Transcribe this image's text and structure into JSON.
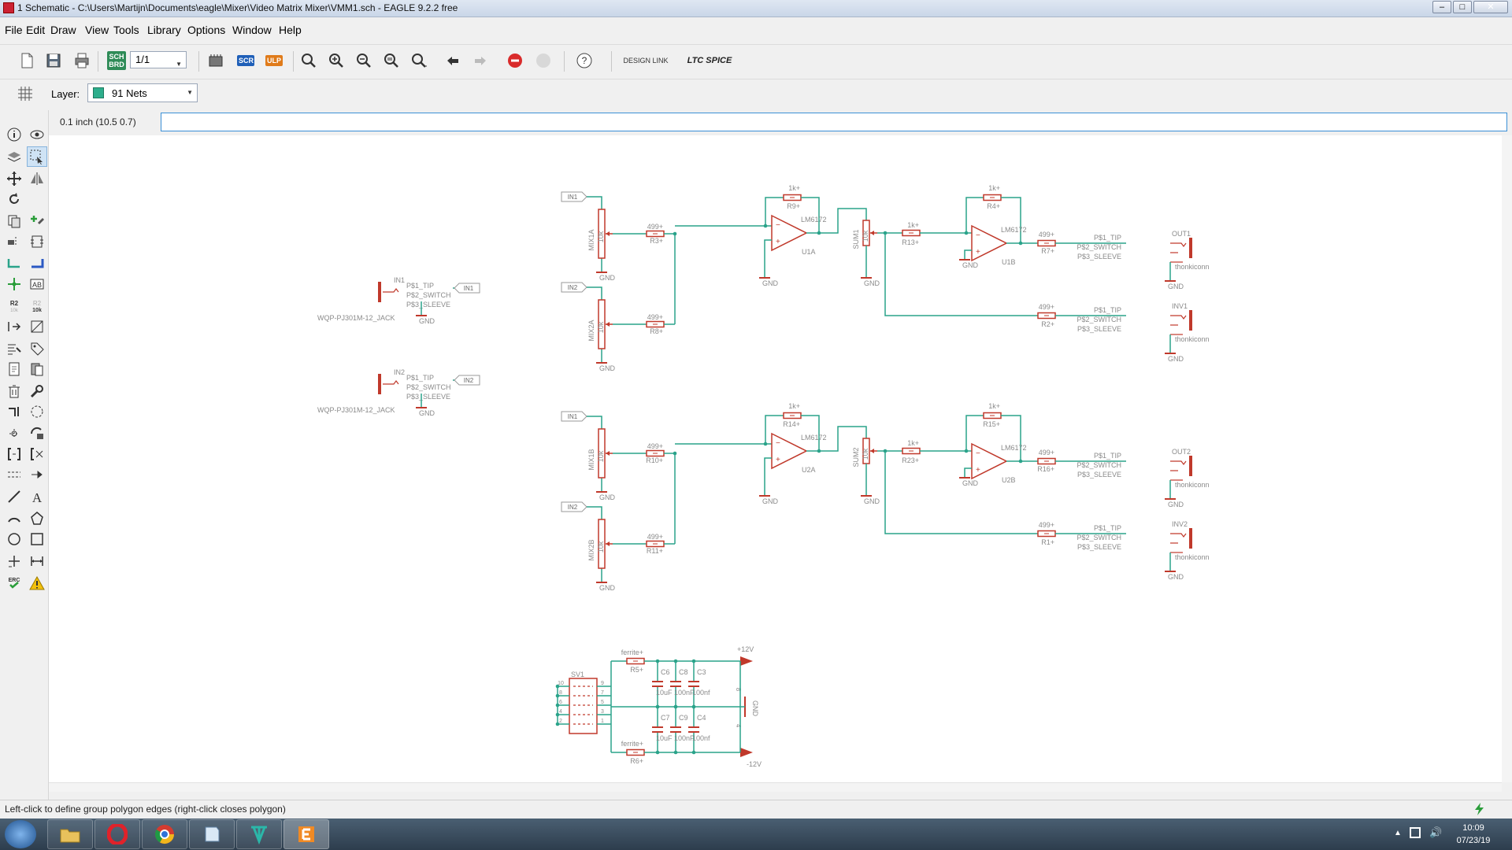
{
  "window": {
    "title": "1 Schematic - C:\\Users\\Martijn\\Documents\\eagle\\Mixer\\Video Matrix Mixer\\VMM1.sch - EAGLE 9.2.2 free"
  },
  "menu": [
    "File",
    "Edit",
    "Draw",
    "View",
    "Tools",
    "Library",
    "Options",
    "Window",
    "Help"
  ],
  "toolbar": {
    "sheet_value": "1/1",
    "scr_label": "SCR",
    "ulp_label": "ULP",
    "sch_brd_label": "SCH BRD",
    "design_link_label": "DESIGN LINK",
    "ltspice_label": "LTC SPICE"
  },
  "layer": {
    "label": "Layer:",
    "value": "91 Nets",
    "color": "#2dae8c"
  },
  "command": {
    "coordinate": "0.1 inch (10.5 0.7)",
    "input_value": ""
  },
  "status": {
    "text": "Left-click to define group polygon edges (right-click closes polygon)"
  },
  "clock": {
    "time": "10:09",
    "date": "07/23/19"
  },
  "colors": {
    "wire": "#2aa38a",
    "part": "#c0392b",
    "label": "#8a8a8a",
    "canvas": "#ffffff"
  },
  "schematic": {
    "jacks": [
      {
        "name": "IN1",
        "pins": [
          "P$1_TIP",
          "P$2_SWITCH",
          "P$3_SLEEVE"
        ],
        "value": "WQP-PJ301M-12_JACK",
        "net": "IN1",
        "gnd": "GND"
      },
      {
        "name": "IN2",
        "pins": [
          "P$1_TIP",
          "P$2_SWITCH",
          "P$3_SLEEVE"
        ],
        "value": "WQP-PJ301M-12_JACK",
        "net": "IN2",
        "gnd": "GND"
      }
    ],
    "pots": [
      {
        "name": "MIX1A",
        "value": "10k",
        "net": "IN1",
        "res": "R3",
        "res_value": "499"
      },
      {
        "name": "MIX2A",
        "value": "10k",
        "net": "IN2",
        "res": "R8",
        "res_value": "499"
      },
      {
        "name": "MIX1B",
        "value": "10k",
        "net": "IN1",
        "res": "R10",
        "res_value": "499"
      },
      {
        "name": "MIX2B",
        "value": "10k",
        "net": "IN2",
        "res": "R11",
        "res_value": "499"
      }
    ],
    "channels": [
      {
        "fb_res": "R9",
        "fb_value": "1k",
        "opamp": "U1A",
        "opamp_value": "LM6172",
        "sum": "SUM1",
        "sum_value": "10k",
        "r_mid": "R13",
        "r_mid_value": "1k",
        "fb2_res": "R4",
        "fb2_value": "1k",
        "opamp2": "U1B",
        "opamp2_value": "LM6172",
        "out_res": "R7",
        "out_value": "499",
        "out_conn": "OUT1",
        "inv_res": "R2",
        "inv_value": "499",
        "inv_conn": "INV1"
      },
      {
        "fb_res": "R14",
        "fb_value": "1k",
        "opamp": "U2A",
        "opamp_value": "LM6172",
        "sum": "SUM2",
        "sum_value": "10k",
        "r_mid": "R23",
        "r_mid_value": "1k",
        "fb2_res": "R15",
        "fb2_value": "1k",
        "opamp2": "U2B",
        "opamp2_value": "LM6172",
        "out_res": "R16",
        "out_value": "499",
        "out_conn": "OUT2",
        "inv_res": "R1",
        "inv_value": "499",
        "inv_conn": "INV2"
      }
    ],
    "conn_pins": [
      "P$1_TIP",
      "P$2_SWITCH",
      "P$3_SLEEVE"
    ],
    "conn_value": "thonkiconn",
    "gnd": "GND",
    "power": {
      "header": "SV1",
      "header_pins": [
        "10",
        "8",
        "6",
        "4",
        "2",
        "9",
        "7",
        "5",
        "3",
        "1"
      ],
      "ferrite_top": {
        "name": "R5",
        "value": "ferrite"
      },
      "ferrite_bot": {
        "name": "R6",
        "value": "ferrite"
      },
      "caps_top": [
        {
          "name": "C6",
          "value": "10uF"
        },
        {
          "name": "C8",
          "value": "100nF"
        },
        {
          "name": "C3",
          "value": "100nf"
        }
      ],
      "caps_bot": [
        {
          "name": "C7",
          "value": "10uF"
        },
        {
          "name": "C9",
          "value": "100nF"
        },
        {
          "name": "C4",
          "value": "100nf"
        }
      ],
      "pos_rail": "+12V",
      "neg_rail": "-12V",
      "gnd": "GND",
      "pin_8": "8",
      "pin_4": "4"
    }
  }
}
